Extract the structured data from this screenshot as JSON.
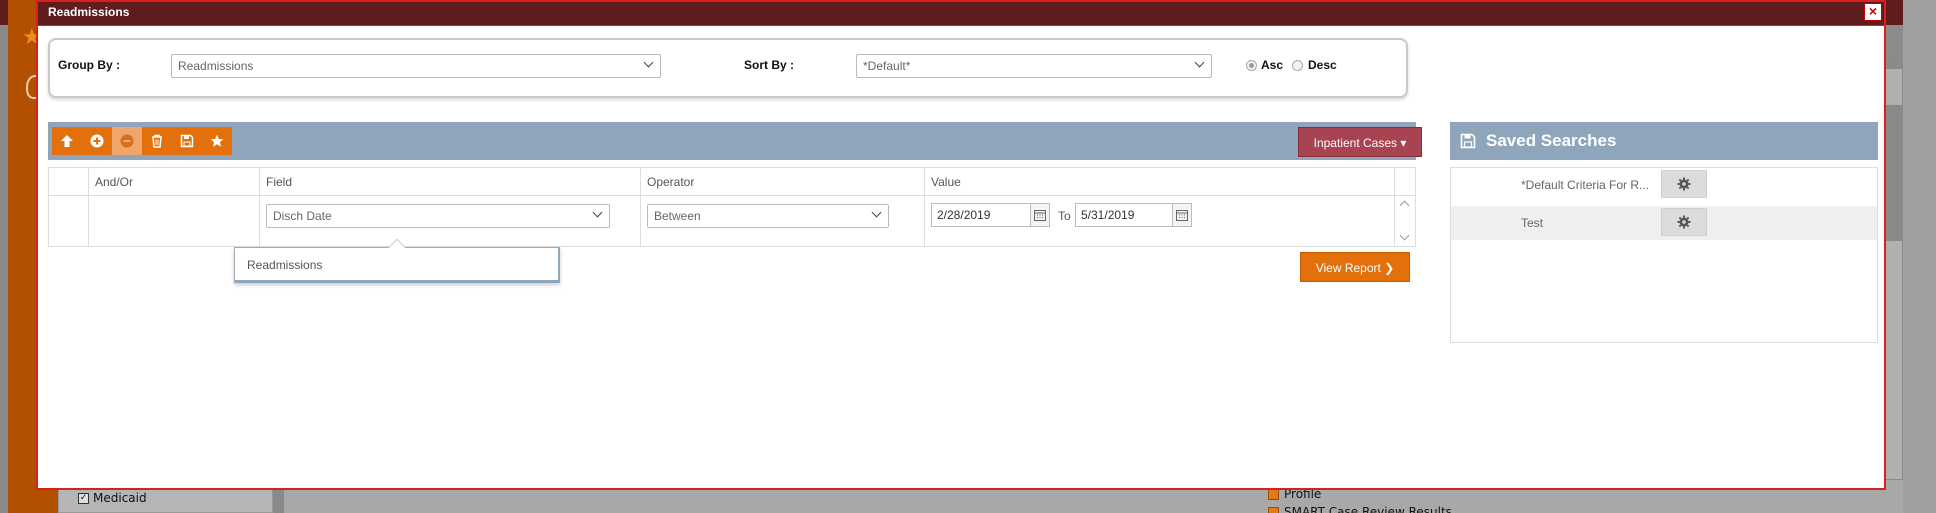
{
  "modal": {
    "title": "Readmissions",
    "close_label": "×"
  },
  "group_by": {
    "label": "Group By :",
    "value": "Readmissions"
  },
  "sort_by": {
    "label": "Sort By :",
    "value": "*Default*"
  },
  "order": {
    "asc_label": "Asc",
    "desc_label": "Desc",
    "selected": "Asc"
  },
  "toolbar": {
    "icons": [
      "arrow-up-icon",
      "plus-circle-icon",
      "minus-circle-icon",
      "trash-icon",
      "save-icon",
      "star-icon"
    ],
    "case_type_label": "Inpatient Cases"
  },
  "grid": {
    "columns": [
      "And/Or",
      "Field",
      "Operator",
      "Value"
    ],
    "rows": [
      {
        "and_or": "",
        "field": "Disch Date",
        "operator": "Between",
        "value_from": "2/28/2019",
        "to_label": "To",
        "value_to": "5/31/2019"
      }
    ]
  },
  "field_dropdown": {
    "options": [
      "Readmissions"
    ]
  },
  "view_report_label": "View Report",
  "saved_searches": {
    "title": "Saved Searches",
    "items": [
      {
        "name": "*Default Criteria For R..."
      },
      {
        "name": "Test"
      }
    ]
  },
  "background": {
    "checkbox_label": "Medicaid",
    "links": [
      "Profile",
      "SMART Case Review Results"
    ]
  },
  "colors": {
    "title_bar": "#5e1c1c",
    "accent_orange": "#e3700a",
    "toolbar_blue": "#8fa5bb",
    "inpatient_button": "#a84451",
    "modal_border": "#d92020"
  }
}
